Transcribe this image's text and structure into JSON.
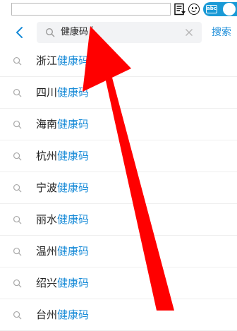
{
  "ime_toolbar": {
    "input_value": "",
    "mode_label": "abc",
    "icons": [
      "note-icon",
      "emoji-icon",
      "abc-icon"
    ]
  },
  "search": {
    "back_icon": "chevron-left-icon",
    "search_icon": "search-icon",
    "query": "健康码",
    "clear_icon": "close-icon",
    "submit_label": "搜索"
  },
  "suggestions": [
    {
      "prefix": "浙江",
      "match": "健康码"
    },
    {
      "prefix": "四川",
      "match": "健康码"
    },
    {
      "prefix": "海南",
      "match": "健康码"
    },
    {
      "prefix": "杭州",
      "match": "健康码"
    },
    {
      "prefix": "宁波",
      "match": "健康码"
    },
    {
      "prefix": "丽水",
      "match": "健康码"
    },
    {
      "prefix": "温州",
      "match": "健康码"
    },
    {
      "prefix": "绍兴",
      "match": "健康码"
    },
    {
      "prefix": "台州",
      "match": "健康码"
    }
  ],
  "colors": {
    "accent": "#1a8cd8",
    "annotation": "#ff0000",
    "search_field_bg": "#f2f3f5",
    "toggle_bg": "#1a9ad6"
  }
}
